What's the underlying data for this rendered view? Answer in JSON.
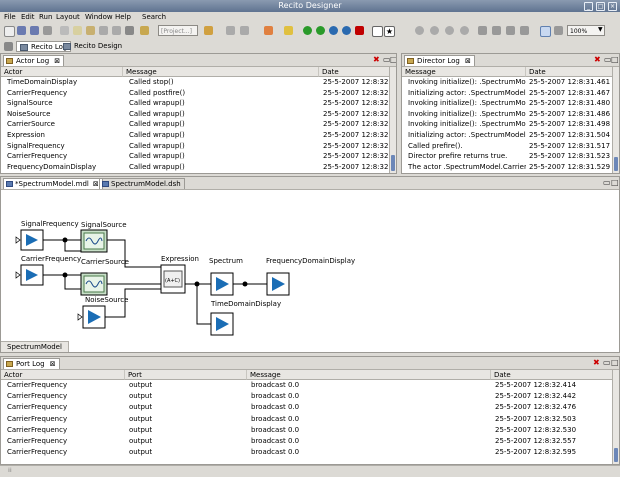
{
  "window": {
    "title": "Recito Designer"
  },
  "menu": [
    "File",
    "Edit",
    "Run",
    "Layout",
    "Window",
    "Help",
    "Search"
  ],
  "toolbar": {
    "combo_text": "[Project...]",
    "zoom": "100%"
  },
  "perspectives": [
    {
      "label": "Recito Log"
    },
    {
      "label": "Recito Design"
    }
  ],
  "actor_log": {
    "tab": "Actor Log",
    "columns": [
      "Actor",
      "Message",
      "Date"
    ],
    "rows": [
      [
        "TimeDomainDisplay",
        "Called stop()",
        "25-5-2007 12:8:32.60"
      ],
      [
        "CarrierFrequency",
        "Called postfire()",
        "25-5-2007 12:8:32.60"
      ],
      [
        "SignalSource",
        "Called wrapup()",
        "25-5-2007 12:8:32.62"
      ],
      [
        "NoiseSource",
        "Called wrapup()",
        "25-5-2007 12:8:32.63"
      ],
      [
        "CarrierSource",
        "Called wrapup()",
        "25-5-2007 12:8:32.64"
      ],
      [
        "Expression",
        "Called wrapup()",
        "25-5-2007 12:8:32.64"
      ],
      [
        "SignalFrequency",
        "Called wrapup()",
        "25-5-2007 12:8:32.65"
      ],
      [
        "CarrierFrequency",
        "Called wrapup()",
        "25-5-2007 12:8:32.66"
      ],
      [
        "FrequencyDomainDisplay",
        "Called wrapup()",
        "25-5-2007 12:8:32.67"
      ]
    ]
  },
  "director_log": {
    "tab": "Director Log",
    "columns": [
      "Message",
      "Date"
    ],
    "rows": [
      [
        "Invoking initialize(): .SpectrumModel.Carr",
        "25-5-2007 12:8:31.461"
      ],
      [
        "Initializing actor: .SpectrumModel.Carrier",
        "25-5-2007 12:8:31.467"
      ],
      [
        "Invoking initialize(): .SpectrumModel.Fr",
        "25-5-2007 12:8:31.480"
      ],
      [
        "Invoking initialize(): .SpectrumModel.freq",
        "25-5-2007 12:8:31.486"
      ],
      [
        "Invoking initialize(): .SpectrumModel.Fre",
        "25-5-2007 12:8:31.498"
      ],
      [
        "Initializing actor: .SpectrumModel.Time",
        "25-5-2007 12:8:31.504"
      ],
      [
        "Called prefire().",
        "25-5-2007 12:8:31.517"
      ],
      [
        "Director prefire returns true.",
        "25-5-2007 12:8:31.523"
      ],
      [
        "The actor .SpectrumModel.CarrierFreq",
        "25-5-2007 12:8:31.529"
      ]
    ]
  },
  "editor": {
    "tabs": [
      "*SpectrumModel.mdl",
      "SpectrumModel.dsh"
    ],
    "model_label": "SpectrumModel",
    "actors": {
      "signal_frequency": "SignalFrequency",
      "signal_source": "SignalSource",
      "carrier_frequency": "CarrierFrequency",
      "carrier_source": "CarrierSource",
      "noise_source": "NoiseSource",
      "expression": "Expression",
      "expression_glyph": "(A+C)",
      "spectrum": "Spectrum",
      "frequency_domain_display": "FrequencyDomainDisplay",
      "time_domain_display": "TimeDomainDisplay"
    }
  },
  "port_log": {
    "tab": "Port Log",
    "columns": [
      "Actor",
      "Port",
      "Message",
      "Date"
    ],
    "rows": [
      [
        "CarrierFrequency",
        "output",
        "broadcast 0.0",
        "25-5-2007 12:8:32.414"
      ],
      [
        "CarrierFrequency",
        "output",
        "broadcast 0.0",
        "25-5-2007 12:8:32.442"
      ],
      [
        "CarrierFrequency",
        "output",
        "broadcast 0.0",
        "25-5-2007 12:8:32.476"
      ],
      [
        "CarrierFrequency",
        "output",
        "broadcast 0.0",
        "25-5-2007 12:8:32.503"
      ],
      [
        "CarrierFrequency",
        "output",
        "broadcast 0.0",
        "25-5-2007 12:8:32.530"
      ],
      [
        "CarrierFrequency",
        "output",
        "broadcast 0.0",
        "25-5-2007 12:8:32.557"
      ],
      [
        "CarrierFrequency",
        "output",
        "broadcast 0.0",
        "25-5-2007 12:8:32.595"
      ]
    ]
  },
  "icons": [
    "new-file-icon",
    "save-icon",
    "save-all-icon",
    "print-icon",
    "cut-icon",
    "copy-icon",
    "paste-icon",
    "undo-icon",
    "run-icon",
    "pause-icon",
    "stop-icon",
    "zoom-in-icon",
    "zoom-out-icon",
    "layout-icon"
  ],
  "colors": {
    "accent": "#2a6ab0",
    "actor_fill": "#1a6db5",
    "title_bar": "#6a7d99",
    "stop_red": "#c00000",
    "run_green": "#2a9a2a"
  }
}
